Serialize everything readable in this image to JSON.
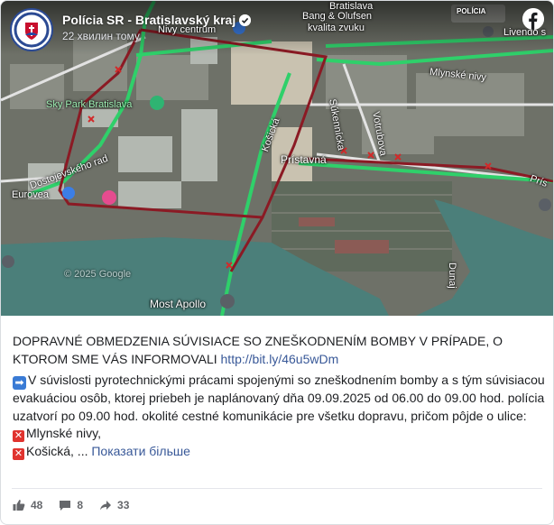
{
  "header": {
    "page_name": "Polícia SR - Bratislavský kraj",
    "timestamp": "22 хвилин тому",
    "verified_icon": "verified-badge-icon",
    "brand_icon": "facebook-logo-icon"
  },
  "map": {
    "labels": {
      "bang_olufsen": "Bang & Olufsen",
      "kvalita_zvuku": "kvalita zvuku",
      "nivy_centrum": "Nivy centrum",
      "bratislava": "Bratislava",
      "livendo": "Livendo s",
      "sky_park": "Sky Park Bratislava",
      "mlynske_nivy": "Mlynské nivy",
      "sukennicka": "Súkennícka",
      "votrubova": "Votrubova",
      "kosicka": "Košická",
      "pristavna": "Prístavná",
      "dostojevskeho": "Dostojevského rad",
      "eurovea": "Eurovea",
      "pris": "Prís",
      "dunaj": "Dunaj",
      "copyright": "© 2025 Google",
      "most_apollo": "Most Apollo",
      "mlyn": "Mlynské",
      "policia_badge": "POLÍCIA"
    },
    "colors": {
      "route": "#8b1a24",
      "traffic_green": "#2fd06a",
      "river": "#4b7f7a"
    }
  },
  "post": {
    "title": "DOPRAVNÉ OBMEDZENIA SÚVISIACE SO ZNEŠKODNENÍM BOMBY V PRÍPADE, O KTOROM SME VÁS INFORMOVALI",
    "link": "http://bit.ly/46u5wDm",
    "body": "V súvislosti pyrotechnickými prácami spojenými so zneškodnením bomby a s tým súvisiacou evakuáciou osôb, ktorej priebeh je naplánovaný dňa 09.09.2025 od 06.00 do 09.00 hod. polícia uzatvorí po 09.00 hod. okolité cestné komunikácie pre všetku dopravu, pričom pôjde o ulice:",
    "item1": "Mlynské nivy,",
    "item2": "Košická, ...",
    "see_more": "Показати більше",
    "arrow_icon": "right-arrow-emoji-icon",
    "cross_icon": "red-cross-mark-emoji-icon"
  },
  "actions": {
    "likes": "48",
    "comments": "8",
    "shares": "33"
  }
}
